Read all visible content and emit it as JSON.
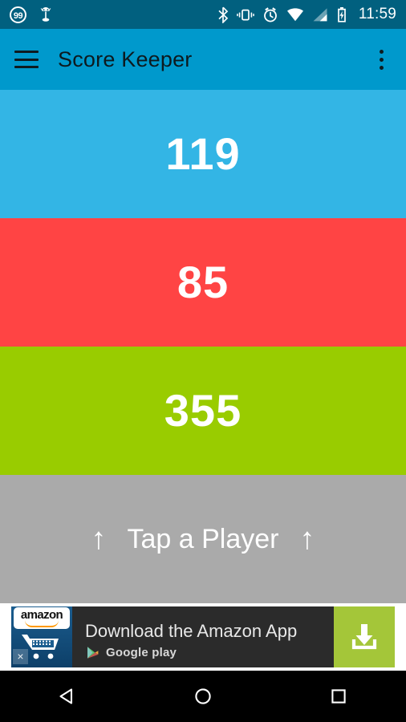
{
  "status_bar": {
    "notification_badge": "99",
    "icons_left": [
      "notification-count-badge",
      "android-robot-icon"
    ],
    "icons_right": [
      "bluetooth-icon",
      "vibrate-icon",
      "alarm-icon",
      "wifi-icon",
      "cell-signal-icon",
      "battery-charging-icon"
    ],
    "time": "11:59",
    "background": "#01607f"
  },
  "app_bar": {
    "title": "Score Keeper",
    "menu_icon": "hamburger-menu-icon",
    "overflow_icon": "overflow-menu-icon",
    "background": "#0099cc",
    "title_color": "#0d1a1f"
  },
  "players": [
    {
      "score": "119",
      "color": "#33b5e5",
      "name": "player-one"
    },
    {
      "score": "85",
      "color": "#ff4444",
      "name": "player-two"
    },
    {
      "score": "355",
      "color": "#99cc00",
      "name": "player-three"
    }
  ],
  "tap_hint": {
    "left_arrow": "↑",
    "text": "Tap a Player",
    "right_arrow": "↑",
    "background": "#aaaaaa",
    "text_color": "#ffffff"
  },
  "ad": {
    "brand": "amazon",
    "headline": "Download the Amazon App",
    "store": "Google play",
    "close_label": "×",
    "icon_name": "amazon-cart-icon",
    "store_icon_name": "google-play-icon",
    "cta_icon_name": "download-icon",
    "cta_color": "#a4c639",
    "background": "#2b2b2b"
  },
  "nav_bar": {
    "back": "back-button",
    "home": "home-button",
    "recents": "recents-button",
    "background": "#000000"
  }
}
